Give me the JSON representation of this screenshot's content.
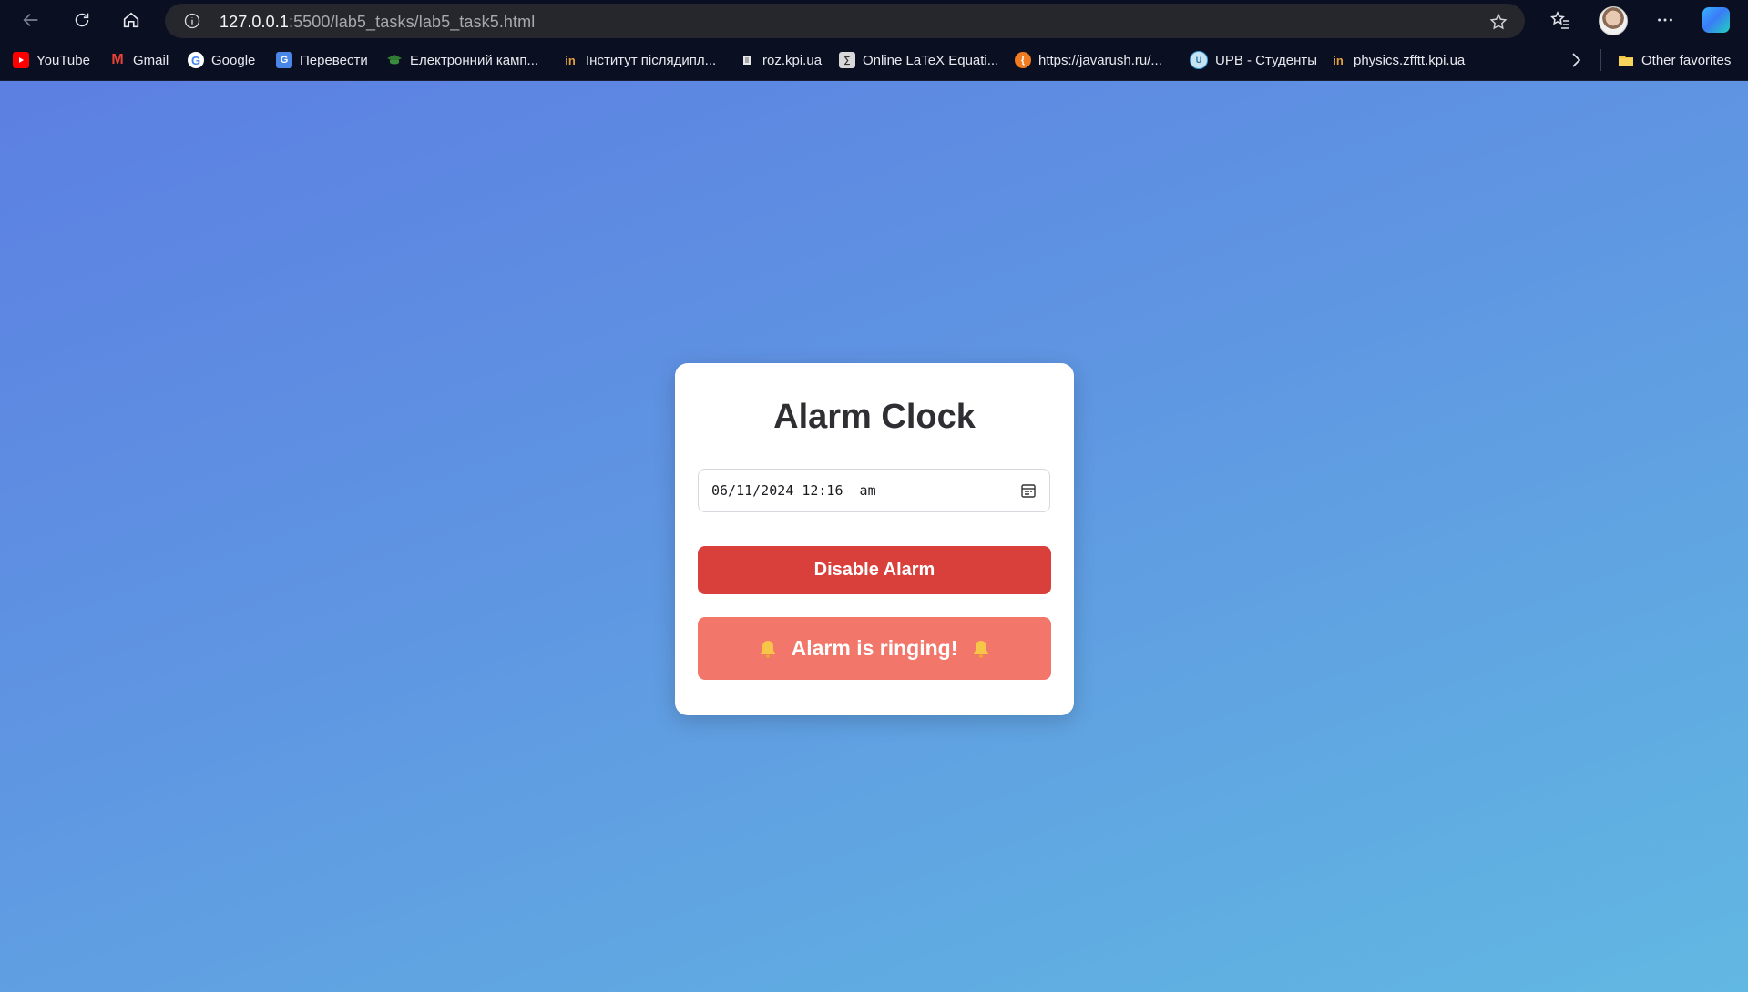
{
  "browser": {
    "url_host": "127.0.0.1",
    "url_path": ":5500/lab5_tasks/lab5_task5.html"
  },
  "bookmarks": [
    {
      "label": "YouTube",
      "icon": "youtube-icon",
      "color": "#ff0000"
    },
    {
      "label": "Gmail",
      "icon": "gmail-icon",
      "color": "#ea4335"
    },
    {
      "label": "Google",
      "icon": "google-icon",
      "color": "#4285f4"
    },
    {
      "label": "Перевести",
      "icon": "translate-icon",
      "color": "#4a86e8"
    },
    {
      "label": "Електронний камп...",
      "icon": "graduation-cap-icon",
      "color": "#2e7d32"
    },
    {
      "label": "Інститут післядипл...",
      "icon": "institute-icon",
      "color": "#e0a040"
    },
    {
      "label": "roz.kpi.ua",
      "icon": "document-icon",
      "color": "#dddddd"
    },
    {
      "label": "Online LaTeX Equati...",
      "icon": "latex-icon",
      "color": "#cccccc"
    },
    {
      "label": "https://javarush.ru/...",
      "icon": "javarush-icon",
      "color": "#f07b20"
    },
    {
      "label": "UPB - Студенты",
      "icon": "upb-icon",
      "color": "#3aa0d8"
    },
    {
      "label": "physics.zfftt.kpi.ua",
      "icon": "institute-icon",
      "color": "#e0a040"
    }
  ],
  "other_favorites": "Other favorites",
  "app": {
    "title": "Alarm Clock",
    "datetime_value": "06/11/2024 12:16  am",
    "disable_button": "Disable Alarm",
    "ringing_text": "Alarm is ringing!"
  },
  "colors": {
    "disable_button": "#d9403c",
    "ringing_banner": "#f2776a",
    "background_start": "#5c7fe2",
    "background_end": "#61b8e2"
  }
}
